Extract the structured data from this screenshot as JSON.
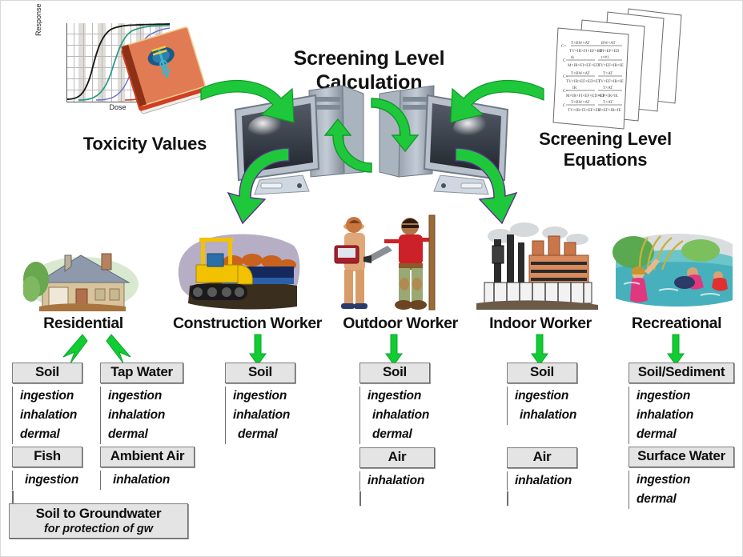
{
  "diagram": {
    "title_screening": "Screening Level\nCalculation",
    "title_toxicity": "Toxicity Values",
    "title_equations": "Screening Level\nEquations"
  },
  "headings": {
    "screening_level_calculation": "Screening Level Calculation",
    "screening_level_calculation_line1": "Screening Level",
    "screening_level_calculation_line2": "Calculation",
    "toxicity_values": "Toxicity Values",
    "screening_level_equations_line1": "Screening Level",
    "screening_level_equations_line2": "Equations"
  },
  "chart_data": {
    "type": "line",
    "title": "",
    "xlabel": "Dose",
    "ylabel": "Response",
    "grid": true,
    "legend": "none",
    "series": [
      {
        "name": "curve-1",
        "color": "#1a1a1a"
      },
      {
        "name": "curve-2",
        "color": "#2e9c86"
      },
      {
        "name": "curve-3",
        "color": "#6f72c6"
      },
      {
        "name": "curve-4",
        "color": "#c23b22"
      }
    ]
  },
  "receptors": [
    {
      "id": "residential",
      "label": "Residential",
      "image": "house-illustration"
    },
    {
      "id": "construction-worker",
      "label": "Construction Worker",
      "image": "bulldozer-illustration"
    },
    {
      "id": "outdoor-worker",
      "label": "Outdoor Worker",
      "image": "outdoor-workers-illustration"
    },
    {
      "id": "indoor-worker",
      "label": "Indoor Worker",
      "image": "factory-illustration"
    },
    {
      "id": "recreational",
      "label": "Recreational",
      "image": "swimmers-illustration"
    }
  ],
  "pathways": {
    "residential_soil": {
      "media": "Soil",
      "routes": [
        "ingestion",
        "inhalation",
        "dermal"
      ]
    },
    "residential_fish": {
      "media": "Fish",
      "routes": [
        "ingestion"
      ]
    },
    "residential_tap": {
      "media": "Tap Water",
      "routes": [
        "ingestion",
        "inhalation",
        "dermal"
      ]
    },
    "residential_air": {
      "media": "Ambient Air",
      "routes": [
        "inhalation"
      ]
    },
    "construction_soil": {
      "media": "Soil",
      "routes": [
        "ingestion",
        "inhalation",
        "dermal"
      ]
    },
    "outdoor_soil": {
      "media": "Soil",
      "routes": [
        "ingestion",
        "inhalation",
        "dermal"
      ]
    },
    "outdoor_air": {
      "media": "Air",
      "routes": [
        "inhalation"
      ]
    },
    "indoor_soil": {
      "media": "Soil",
      "routes": [
        "ingestion",
        "inhalation"
      ]
    },
    "indoor_air": {
      "media": "Air",
      "routes": [
        "inhalation"
      ]
    },
    "recreational_soil": {
      "media": "Soil/Sediment",
      "routes": [
        "ingestion",
        "inhalation",
        "dermal"
      ]
    },
    "recreational_water": {
      "media": "Surface Water",
      "routes": [
        "ingestion",
        "dermal"
      ]
    }
  },
  "groundwater": {
    "title": "Soil to Groundwater",
    "subtitle": "for protection of gw"
  },
  "colors": {
    "arrow_green": "#11CC33",
    "arrow_green_dark": "#0aa82a",
    "box_fill": "#e4e4e4",
    "box_border": "#7d7d7d",
    "text": "#0d0d0d"
  }
}
